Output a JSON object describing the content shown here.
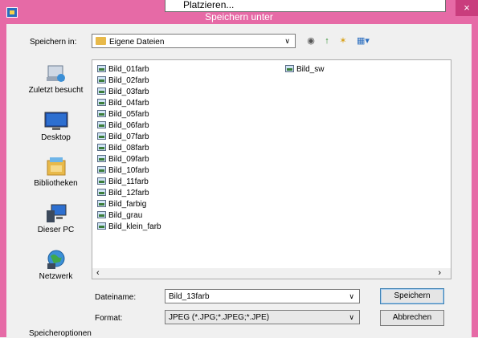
{
  "window": {
    "title": "Speichern unter",
    "close_glyph": "×"
  },
  "popup": {
    "text": "Platzieren..."
  },
  "location": {
    "label": "Speichern in:",
    "value": "Eigene Dateien"
  },
  "toolbar": {
    "back": "◉",
    "up": "↑",
    "new_folder": "✶",
    "view": "▦▾"
  },
  "places": [
    {
      "label": "Zuletzt besucht",
      "icon": "recent-icon"
    },
    {
      "label": "Desktop",
      "icon": "desktop-icon"
    },
    {
      "label": "Bibliotheken",
      "icon": "libraries-icon"
    },
    {
      "label": "Dieser PC",
      "icon": "this-pc-icon"
    },
    {
      "label": "Netzwerk",
      "icon": "network-icon"
    }
  ],
  "files_col1": [
    "Bild_01farb",
    "Bild_02farb",
    "Bild_03farb",
    "Bild_04farb",
    "Bild_05farb",
    "Bild_06farb",
    "Bild_07farb",
    "Bild_08farb",
    "Bild_09farb",
    "Bild_10farb",
    "Bild_11farb",
    "Bild_12farb",
    "Bild_farbig",
    "Bild_grau",
    "Bild_klein_farb"
  ],
  "files_col2": [
    "Bild_sw"
  ],
  "filename": {
    "label": "Dateiname:",
    "value": "Bild_13farb"
  },
  "format": {
    "label": "Format:",
    "value": "JPEG (*.JPG;*.JPEG;*.JPE)"
  },
  "buttons": {
    "save": "Speichern",
    "cancel": "Abbrechen"
  },
  "options_label": "Speicheroptionen"
}
